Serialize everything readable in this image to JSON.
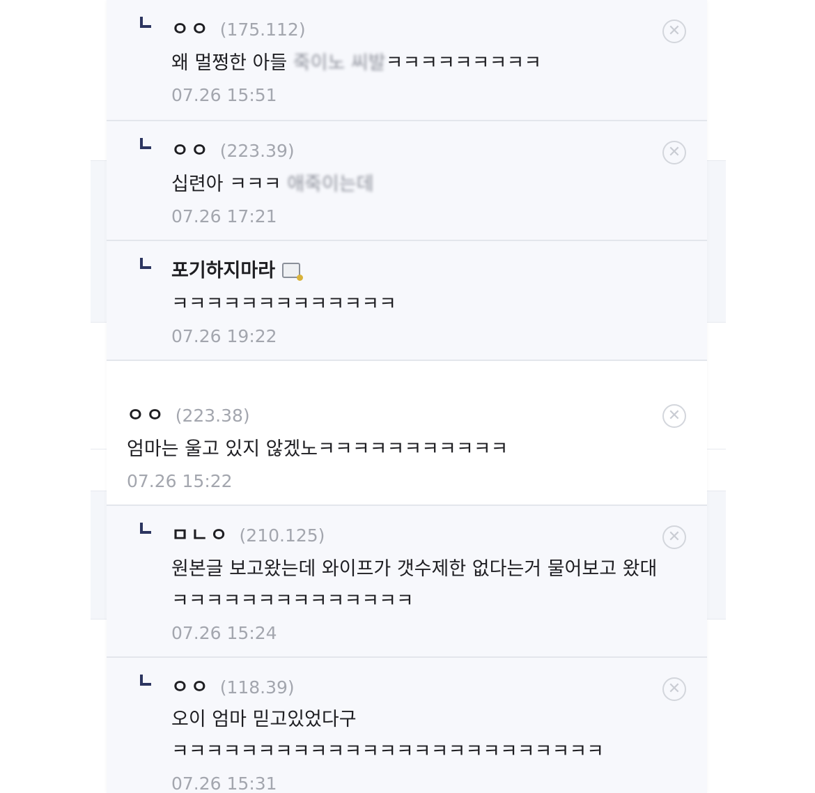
{
  "comments": [
    {
      "type": "reply",
      "nick": "ㅇㅇ",
      "ip": "(175.112)",
      "body": "왜 멀쩡한 아들 ",
      "body_blurred": "죽이노 씨발",
      "body_tail": "ㅋㅋㅋㅋㅋㅋㅋㅋㅋ",
      "date": "07.26 15:51"
    },
    {
      "type": "reply",
      "nick": "ㅇㅇ",
      "ip": "(223.39)",
      "body": "십련아 ㅋㅋㅋ ",
      "body_blurred": "애죽이는데",
      "body_tail": "",
      "date": "07.26 17:21"
    },
    {
      "type": "reply",
      "nick": "포기하지마라",
      "ip": "",
      "body": "ㅋㅋㅋㅋㅋㅋㅋㅋㅋㅋㅋㅋㅋ",
      "body_blurred": "",
      "body_tail": "",
      "date": "07.26 19:22"
    },
    {
      "type": "root",
      "nick": "ㅇㅇ",
      "ip": "(223.38)",
      "body": "엄마는 울고 있지 않겠노ㅋㅋㅋㅋㅋㅋㅋㅋㅋㅋㅋ",
      "body_blurred": "",
      "body_tail": "",
      "date": "07.26 15:22"
    },
    {
      "type": "reply",
      "nick": "ㅁㄴㅇ",
      "ip": "(210.125)",
      "body": "원본글 보고왔는데 와이프가 갯수제한 없다는거 물어보고 왔대 ㅋㅋㅋㅋㅋㅋㅋㅋㅋㅋㅋㅋㅋㅋ",
      "body_blurred": "",
      "body_tail": "",
      "date": "07.26 15:24"
    },
    {
      "type": "reply",
      "nick": "ㅇㅇ",
      "ip": "(118.39)",
      "body": "오이 엄마 믿고있었다구 ㅋㅋㅋㅋㅋㅋㅋㅋㅋㅋㅋㅋㅋㅋㅋㅋㅋㅋㅋㅋㅋㅋㅋㅋㅋ",
      "body_blurred": "",
      "body_tail": "",
      "date": "07.26 15:31"
    }
  ],
  "icons": {
    "reply": "reply-arrow-icon",
    "delete": "close-circle-icon",
    "badge": "fixed-nick-badge-icon"
  },
  "colors": {
    "nick": "#1e1e22",
    "meta": "#a3a6ae",
    "reply_bg": "#f7f8fc",
    "divider": "#e3e6ec"
  }
}
